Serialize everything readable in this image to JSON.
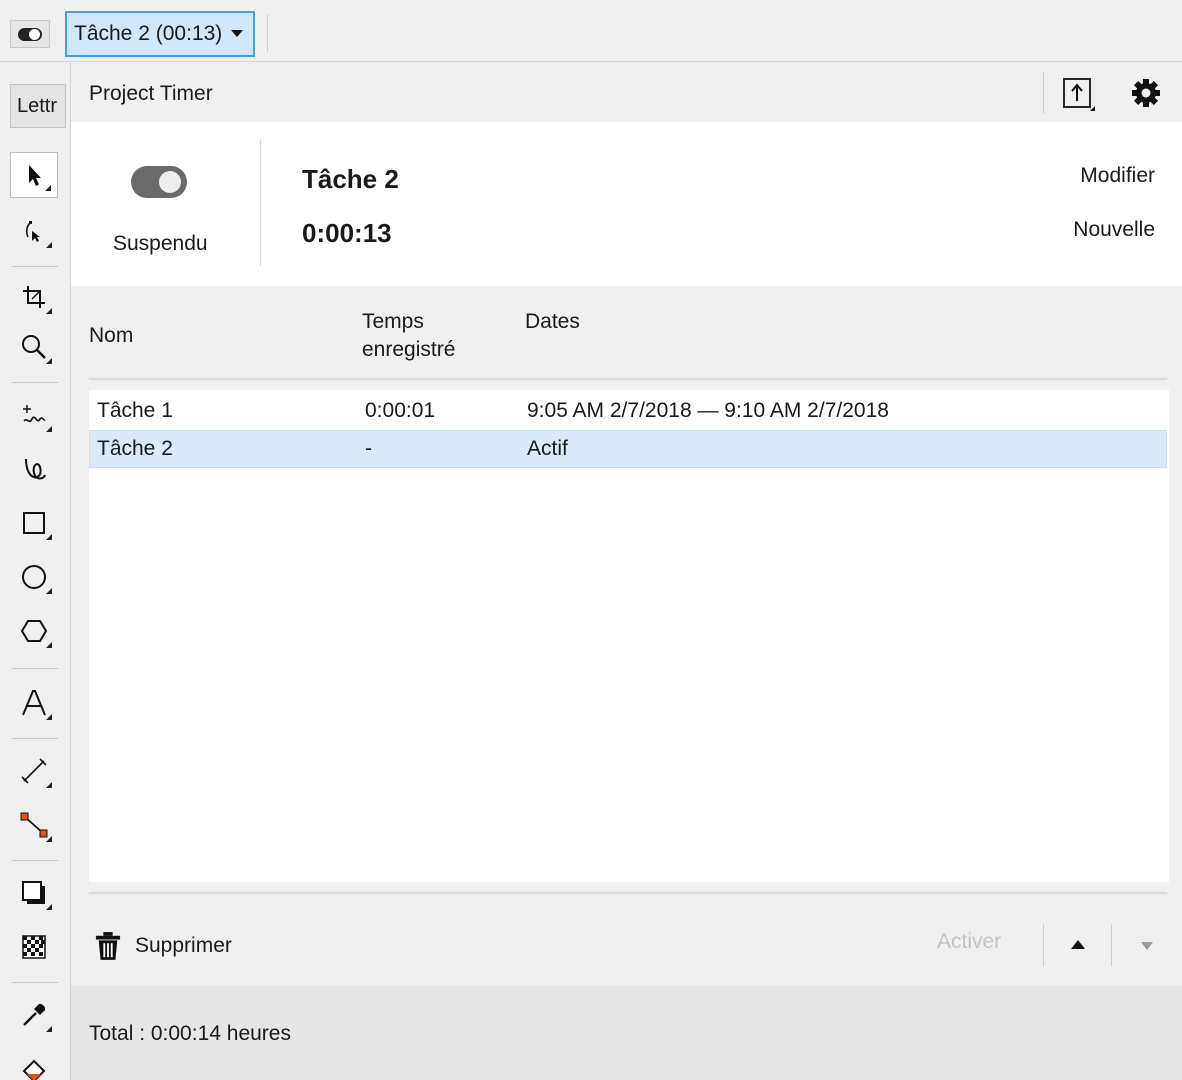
{
  "topbar": {
    "task_selector": "Tâche 2 (00:13)"
  },
  "toolbox": {
    "property_tab": "Lettr",
    "tools": [
      "pick-tool",
      "shape-tool",
      "crop-tool",
      "zoom-tool",
      "freehand-tool",
      "artistic-media-tool",
      "rectangle-tool",
      "ellipse-tool",
      "polygon-tool",
      "text-tool",
      "parallel-dimension-tool",
      "connector-tool",
      "drop-shadow-tool",
      "transparency-tool",
      "eyedropper-tool",
      "fill-tool"
    ]
  },
  "panel": {
    "title": "Project Timer",
    "status": {
      "label": "Suspendu",
      "task_name": "Tâche 2",
      "elapsed": "0:00:13",
      "modify_label": "Modifier",
      "new_label": "Nouvelle"
    },
    "table": {
      "columns": [
        "Nom",
        "Temps\nenregistré",
        "Dates"
      ],
      "rows": [
        {
          "name": "Tâche 1",
          "time": "0:00:01",
          "dates": "9:05 AM 2/7/2018 — 9:10 AM 2/7/2018",
          "selected": false
        },
        {
          "name": "Tâche 2",
          "time": "-",
          "dates": "Actif",
          "selected": true
        }
      ]
    },
    "actions": {
      "delete_label": "Supprimer",
      "activate_label": "Activer"
    },
    "total": "Total : 0:00:14 heures"
  },
  "colors": {
    "selection_fill": "#d9ebfb",
    "selector_border": "#4a9ee6",
    "panel_bg": "#f0f0f0"
  }
}
